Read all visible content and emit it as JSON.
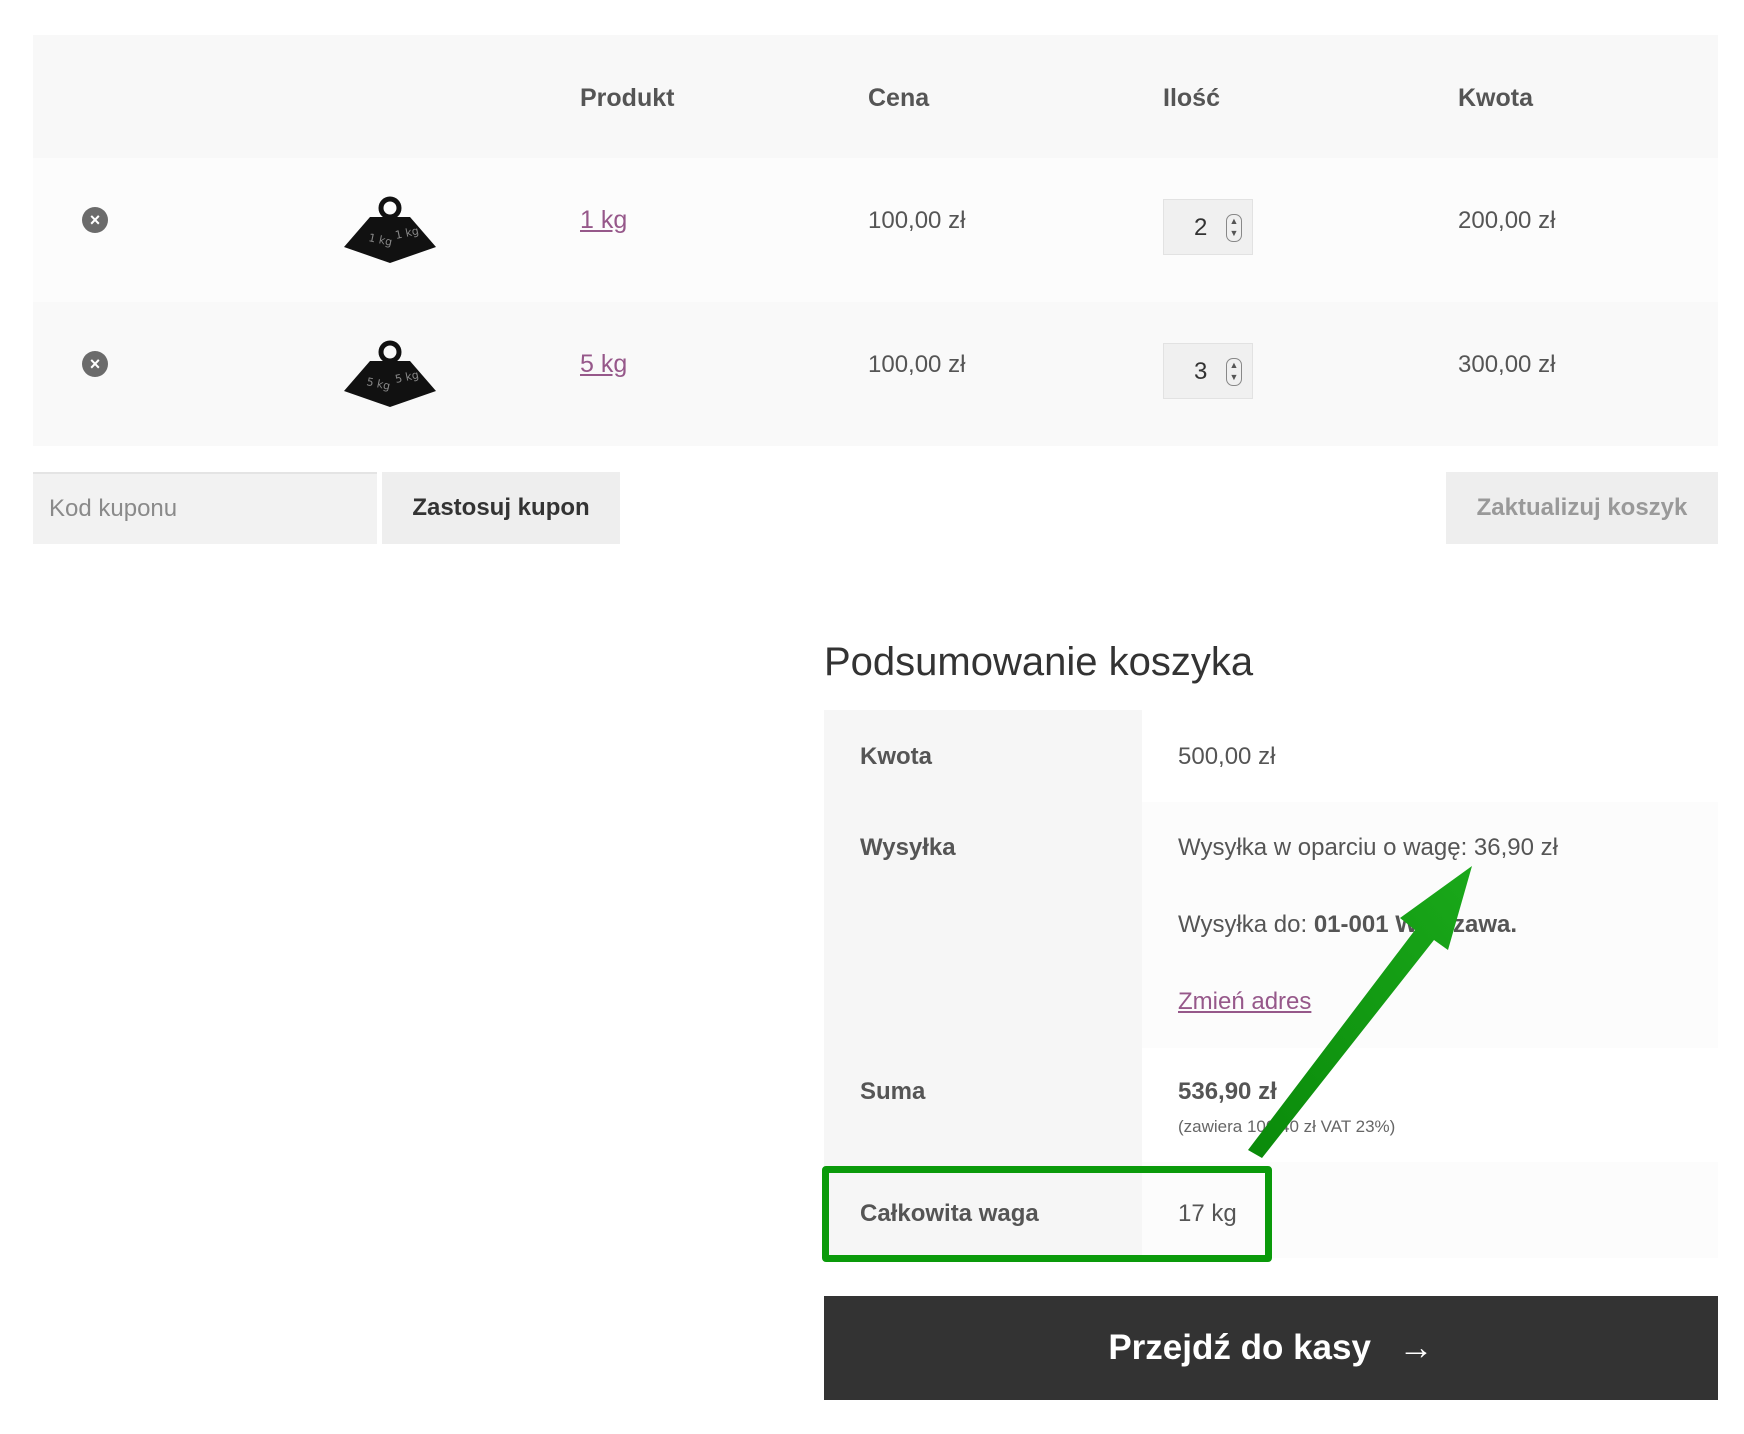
{
  "table": {
    "headers": {
      "product": "Produkt",
      "price": "Cena",
      "quantity": "Ilość",
      "subtotal": "Kwota"
    },
    "rows": [
      {
        "name": "1 kg",
        "weight_label": "1 kg",
        "price": "100,00 zł",
        "qty": "2",
        "subtotal": "200,00 zł"
      },
      {
        "name": "5 kg",
        "weight_label": "5 kg",
        "price": "100,00 zł",
        "qty": "3",
        "subtotal": "300,00 zł"
      }
    ]
  },
  "coupon": {
    "placeholder": "Kod kuponu",
    "apply_label": "Zastosuj kupon",
    "update_label": "Zaktualizuj koszyk"
  },
  "totals": {
    "title": "Podsumowanie koszyka",
    "subtotal_label": "Kwota",
    "subtotal_value": "500,00 zł",
    "shipping_label": "Wysyłka",
    "shipping_method": "Wysyłka w oparciu o wagę: 36,90 zł",
    "shipping_to_prefix": "Wysyłka do: ",
    "shipping_to_place": "01-001 Warszawa.",
    "change_address": "Zmień adres",
    "total_label": "Suma",
    "total_value": "536,90 zł",
    "tax_note": "(zawiera 100,40 zł VAT 23%)",
    "weight_label": "Całkowita waga",
    "weight_value": "17 kg"
  },
  "checkout": {
    "label": "Przejdź do kasy",
    "arrow": "→"
  },
  "colors": {
    "accent": "#96588a",
    "highlight": "#0a9a0a",
    "checkout_bg": "#333333"
  }
}
